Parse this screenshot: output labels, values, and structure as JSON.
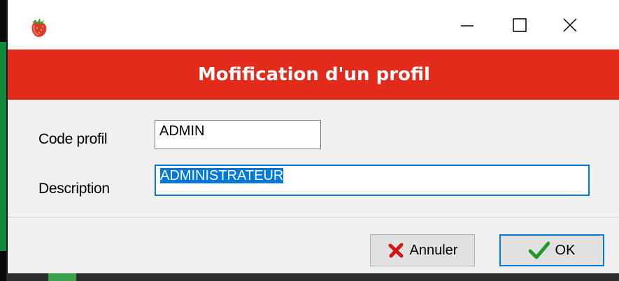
{
  "window": {
    "icon": "strawberry-icon",
    "controls": [
      "minimize-icon",
      "maximize-icon",
      "close-icon"
    ]
  },
  "header": {
    "title": "Mofification d'un profil",
    "color": "#e32b1b"
  },
  "form": {
    "code_label": "Code profil",
    "code_value": "ADMIN",
    "desc_label": "Description",
    "desc_value": "ADMINISTRATEUR"
  },
  "buttons": {
    "cancel_label": "Annuler",
    "cancel_icon": "red-x-icon",
    "ok_label": "OK",
    "ok_icon": "green-check-icon"
  }
}
